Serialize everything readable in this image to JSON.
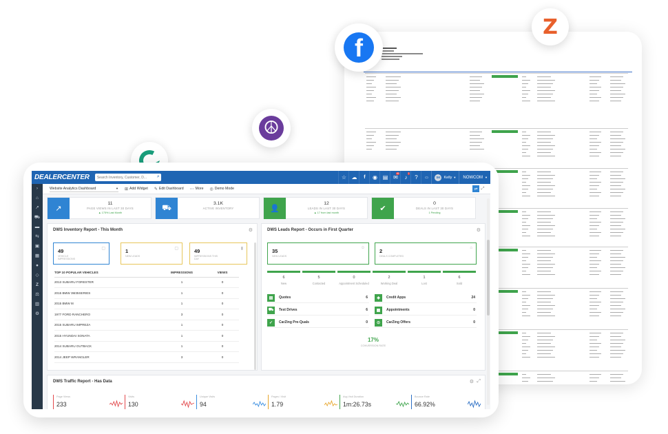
{
  "floating_icons": [
    "facebook-icon",
    "zillow-z-icon",
    "peace-icon",
    "carzing-icon"
  ],
  "topnav": {
    "logo": "DEALERCENTER",
    "search_placeholder": "Search Inventory, Customer, D...",
    "badges": {
      "messages": "45",
      "bell": "2"
    },
    "user_initials": "SK",
    "user_name": "Kelly",
    "company": "NOWCOM"
  },
  "toolbar": {
    "dashboard": "Website Analytics Dashboard",
    "add_widget": "Add Widget",
    "edit_dashboard": "Edit Dashboard",
    "more": "More",
    "demo_mode": "Demo Mode"
  },
  "kpis": [
    {
      "value": "11",
      "label": "PAGE VIEWS IN LAST 30 DAYS",
      "sub": "▲ 175% Last Month",
      "color": "#2f84d3"
    },
    {
      "value": "3.1K",
      "label": "ACTIVE INVENTORY",
      "sub": "",
      "color": "#2f84d3"
    },
    {
      "value": "12",
      "label": "LEADS IN LAST 30 DAYS",
      "sub": "▲ 17 from last month",
      "color": "#3fa44c"
    },
    {
      "value": "0",
      "label": "DEALS IN LAST 30 DAYS",
      "sub": "1 Pending",
      "color": "#3fa44c"
    }
  ],
  "inventory": {
    "title": "DWS Inventory Report - This Month",
    "metrics": [
      {
        "value": "49",
        "label": "VEHICLE IMPRESSIONS"
      },
      {
        "value": "1",
        "label": "NEW LEADS"
      },
      {
        "value": "49",
        "label": "IMPRESSIONS THIS DAY"
      }
    ],
    "table_headers": [
      "TOP 10 POPULAR VEHICLES",
      "IMPRESSIONS",
      "VIEWS"
    ],
    "rows": [
      [
        "2013 SUBARU FORESTER",
        "1",
        "0"
      ],
      [
        "2015 BMW 3M35SERIES",
        "1",
        "0"
      ],
      [
        "2015 BMW I8",
        "1",
        "0"
      ],
      [
        "1977 FORD RANCHERO",
        "3",
        "0"
      ],
      [
        "2015 SUBARU IMPREZA",
        "1",
        "0"
      ],
      [
        "2015 HYUNDAI SONATA",
        "1",
        "0"
      ],
      [
        "2014 SUBARU OUTBACK",
        "1",
        "0"
      ],
      [
        "2014 JEEP WRANGLER",
        "3",
        "0"
      ]
    ]
  },
  "leads": {
    "title": "DWS Leads Report - Occurs in First Quarter",
    "metrics": [
      {
        "value": "35",
        "label": "NEW LEADS"
      },
      {
        "value": "2",
        "label": "DEALS COMPLETED"
      }
    ],
    "stages": [
      {
        "value": "6",
        "label": "New"
      },
      {
        "value": "5",
        "label": "Contacted"
      },
      {
        "value": "0",
        "label": "Appointment Scheduled"
      },
      {
        "value": "2",
        "label": "Working Deal"
      },
      {
        "value": "1",
        "label": "Lost"
      },
      {
        "value": "6",
        "label": "Sold"
      }
    ],
    "left_items": [
      {
        "label": "Quotes",
        "value": "6"
      },
      {
        "label": "Test Drives",
        "value": "6"
      },
      {
        "label": "CarZing Pre-Quals",
        "value": "0"
      }
    ],
    "right_items": [
      {
        "label": "Credit Apps",
        "value": "24"
      },
      {
        "label": "Appointments",
        "value": "0"
      },
      {
        "label": "CarZing Offers",
        "value": "0"
      }
    ],
    "conversion": "17%",
    "conversion_label": "CONVERSION RATE"
  },
  "traffic": {
    "title": "DWS Traffic Report - Has Data",
    "metrics": [
      {
        "label": "Page Views",
        "value": "233",
        "color": "#e2484b"
      },
      {
        "label": "Visits",
        "value": "130",
        "color": "#e2484b"
      },
      {
        "label": "Unique Visits",
        "value": "94",
        "color": "#3a8ee0"
      },
      {
        "label": "Pages / Visit",
        "value": "1.79",
        "color": "#e7a52b"
      },
      {
        "label": "Avg Visit Duration",
        "value": "1m:26.73s",
        "color": "#3fa44c"
      },
      {
        "label": "Bounce Rate",
        "value": "66.92%",
        "color": "#2b6ec4"
      }
    ]
  },
  "colors": {
    "primary": "#1f65b3",
    "green": "#3fa44c",
    "sidebar": "#283848",
    "facebook": "#1877f2",
    "zillow": "#e8602c",
    "peace": "#6a3c9c",
    "carzing": "#1a9e7c"
  }
}
